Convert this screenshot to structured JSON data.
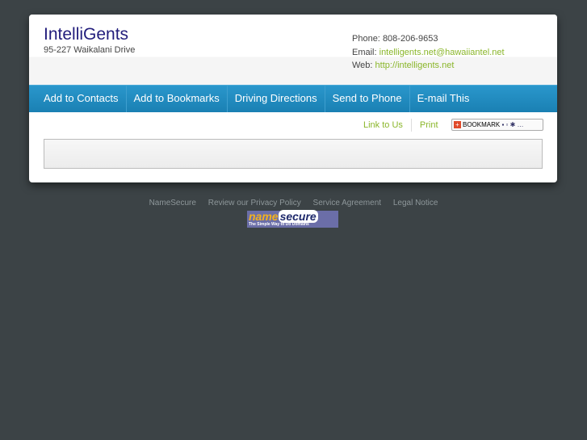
{
  "business": {
    "name": "IntelliGents",
    "address": "95-227 Waikalani Drive",
    "phone_label": "Phone:",
    "phone": "808-206-9653",
    "email_label": "Email:",
    "email": "intelligents.net@hawaiiantel.net",
    "web_label": "Web:",
    "web": "http://intelligents.net"
  },
  "nav": [
    "Add to Contacts",
    "Add to Bookmarks",
    "Driving Directions",
    "Send to Phone",
    "E-mail This"
  ],
  "links": {
    "link_to_us": "Link to Us",
    "print": "Print",
    "bookmark": "BOOKMARK"
  },
  "footer": {
    "links": [
      "NameSecure",
      "Review our Privacy Policy",
      "Service Agreement",
      "Legal Notice"
    ],
    "logo_name": "name",
    "logo_secure": "secure",
    "logo_tagline": "The Simple Way to Do Domains"
  }
}
